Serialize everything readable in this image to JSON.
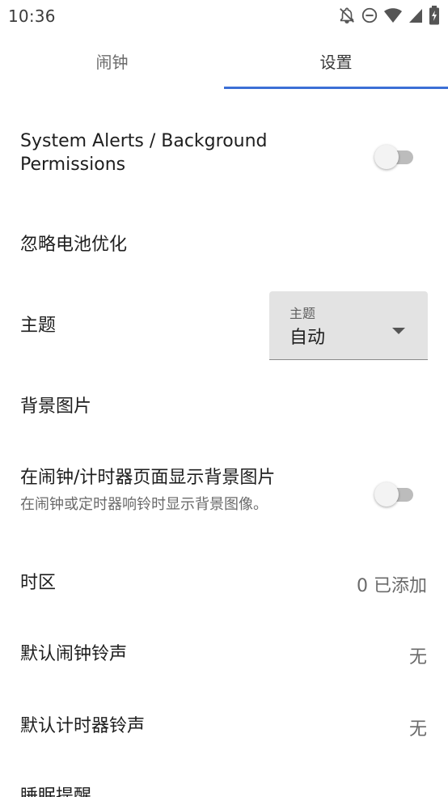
{
  "status_bar": {
    "time": "10:36",
    "icons": [
      "notifications-off-icon",
      "do-not-disturb-icon",
      "wifi-icon",
      "cellular-signal-icon",
      "battery-charging-icon"
    ]
  },
  "tabs": [
    {
      "label": "闹钟",
      "selected": false
    },
    {
      "label": "设置",
      "selected": true
    }
  ],
  "accent_color": "#3c6fd6",
  "settings": {
    "system_alerts": {
      "title_line1": "System Alerts / Background",
      "title_line2": "Permissions",
      "enabled": false
    },
    "battery": {
      "title": "忽略电池优化"
    },
    "theme": {
      "title": "主题",
      "dropdown_label": "主题",
      "dropdown_value": "自动"
    },
    "background_image": {
      "title": "背景图片"
    },
    "show_bg": {
      "title": "在闹钟/计时器页面显示背景图片",
      "subtitle": "在闹钟或定时器响铃时显示背景图像。",
      "enabled": false
    },
    "timezone": {
      "title": "时区",
      "value": "0 已添加"
    },
    "alarm_ringtone": {
      "title": "默认闹钟铃声",
      "value": "无"
    },
    "timer_ringtone": {
      "title": "默认计时器铃声",
      "value": "无"
    },
    "sleep_reminder": {
      "title": "睡眠提醒"
    }
  }
}
